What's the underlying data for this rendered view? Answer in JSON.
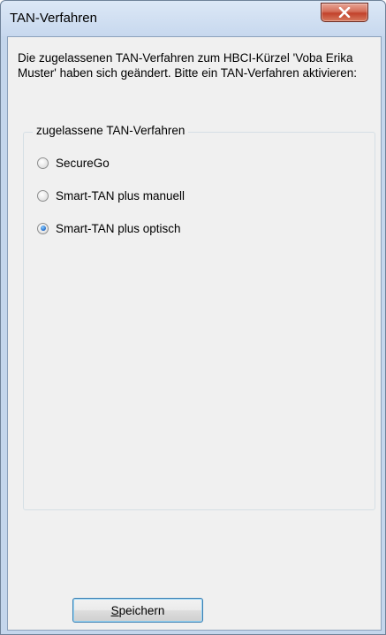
{
  "window": {
    "title": "TAN-Verfahren",
    "close_icon": "close-icon"
  },
  "message": "Die zugelassenen TAN-Verfahren zum HBCI-Kürzel 'Voba Erika Muster' haben sich geändert. Bitte ein TAN-Verfahren aktivieren:",
  "group": {
    "label": "zugelassene TAN-Verfahren",
    "options": [
      {
        "label": "SecureGo",
        "checked": false
      },
      {
        "label": "Smart-TAN plus manuell",
        "checked": false
      },
      {
        "label": "Smart-TAN plus optisch",
        "checked": true
      }
    ]
  },
  "save_button": {
    "mnemonic": "S",
    "rest": "peichern"
  },
  "colors": {
    "title_bar": "#c7d8ee",
    "close_button": "#c2422b",
    "dialog_background": "#f0f0f0",
    "radio_selected": "#1e68c8"
  }
}
